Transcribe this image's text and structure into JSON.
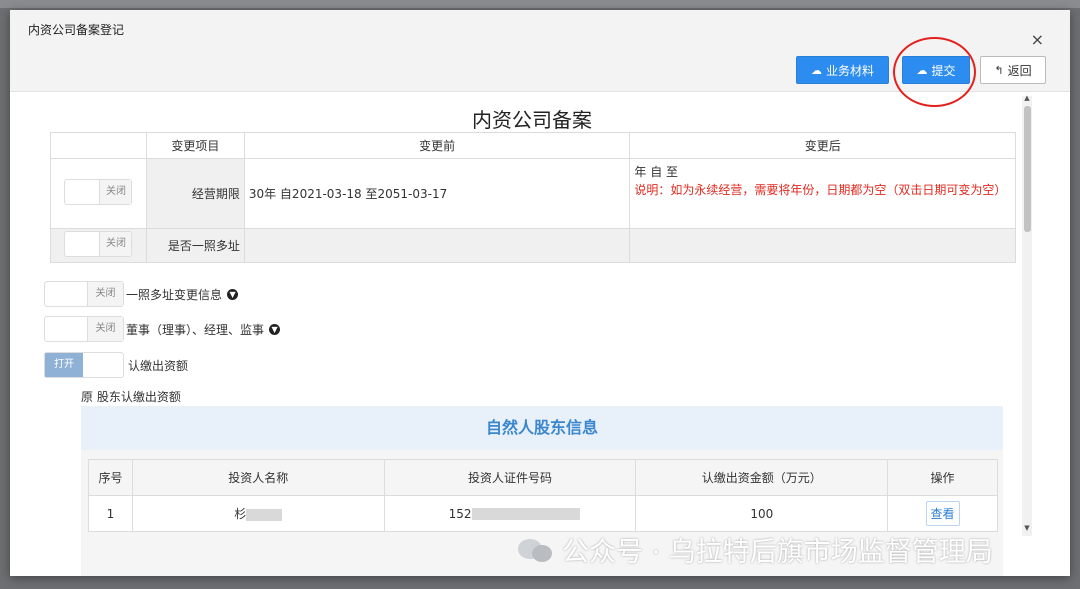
{
  "modal": {
    "title": "内资公司备案登记",
    "close": "×"
  },
  "toolbar": {
    "materials_label": "业务材料",
    "submit_label": "提交",
    "back_label": "返回"
  },
  "page_title": "内资公司备案",
  "change_table": {
    "headers": [
      "变更项目",
      "变更前",
      "变更后"
    ],
    "rows": [
      {
        "toggle": "关闭",
        "item": "经营期限",
        "before": "30年  自2021-03-18 至2051-03-17",
        "after": "年  自 至",
        "note": "说明：如为永续经营，需要将年份，日期都为空（双击日期可变为空）"
      },
      {
        "toggle": "关闭",
        "item": "是否一照多址",
        "before": "",
        "after": ""
      }
    ]
  },
  "sections": [
    {
      "toggle": "关闭",
      "label": "一照多址变更信息",
      "expand_icon": "chevron-down-icon"
    },
    {
      "toggle": "关闭",
      "label": "董事（理事）、经理、监事",
      "expand_icon": "chevron-down-icon"
    },
    {
      "toggle": "打开",
      "label": "认缴出资额"
    }
  ],
  "original_label": "原 股东认缴出资额",
  "shareholder": {
    "title": "自然人股东信息",
    "headers": [
      "序号",
      "投资人名称",
      "投资人证件号码",
      "认缴出资金额（万元）",
      "操作"
    ],
    "rows": [
      {
        "index": "1",
        "name": "杉",
        "id_number": "152",
        "amount": "100",
        "action": "查看"
      }
    ]
  },
  "watermark": "公众号 · 乌拉特后旗市场监督管理局"
}
